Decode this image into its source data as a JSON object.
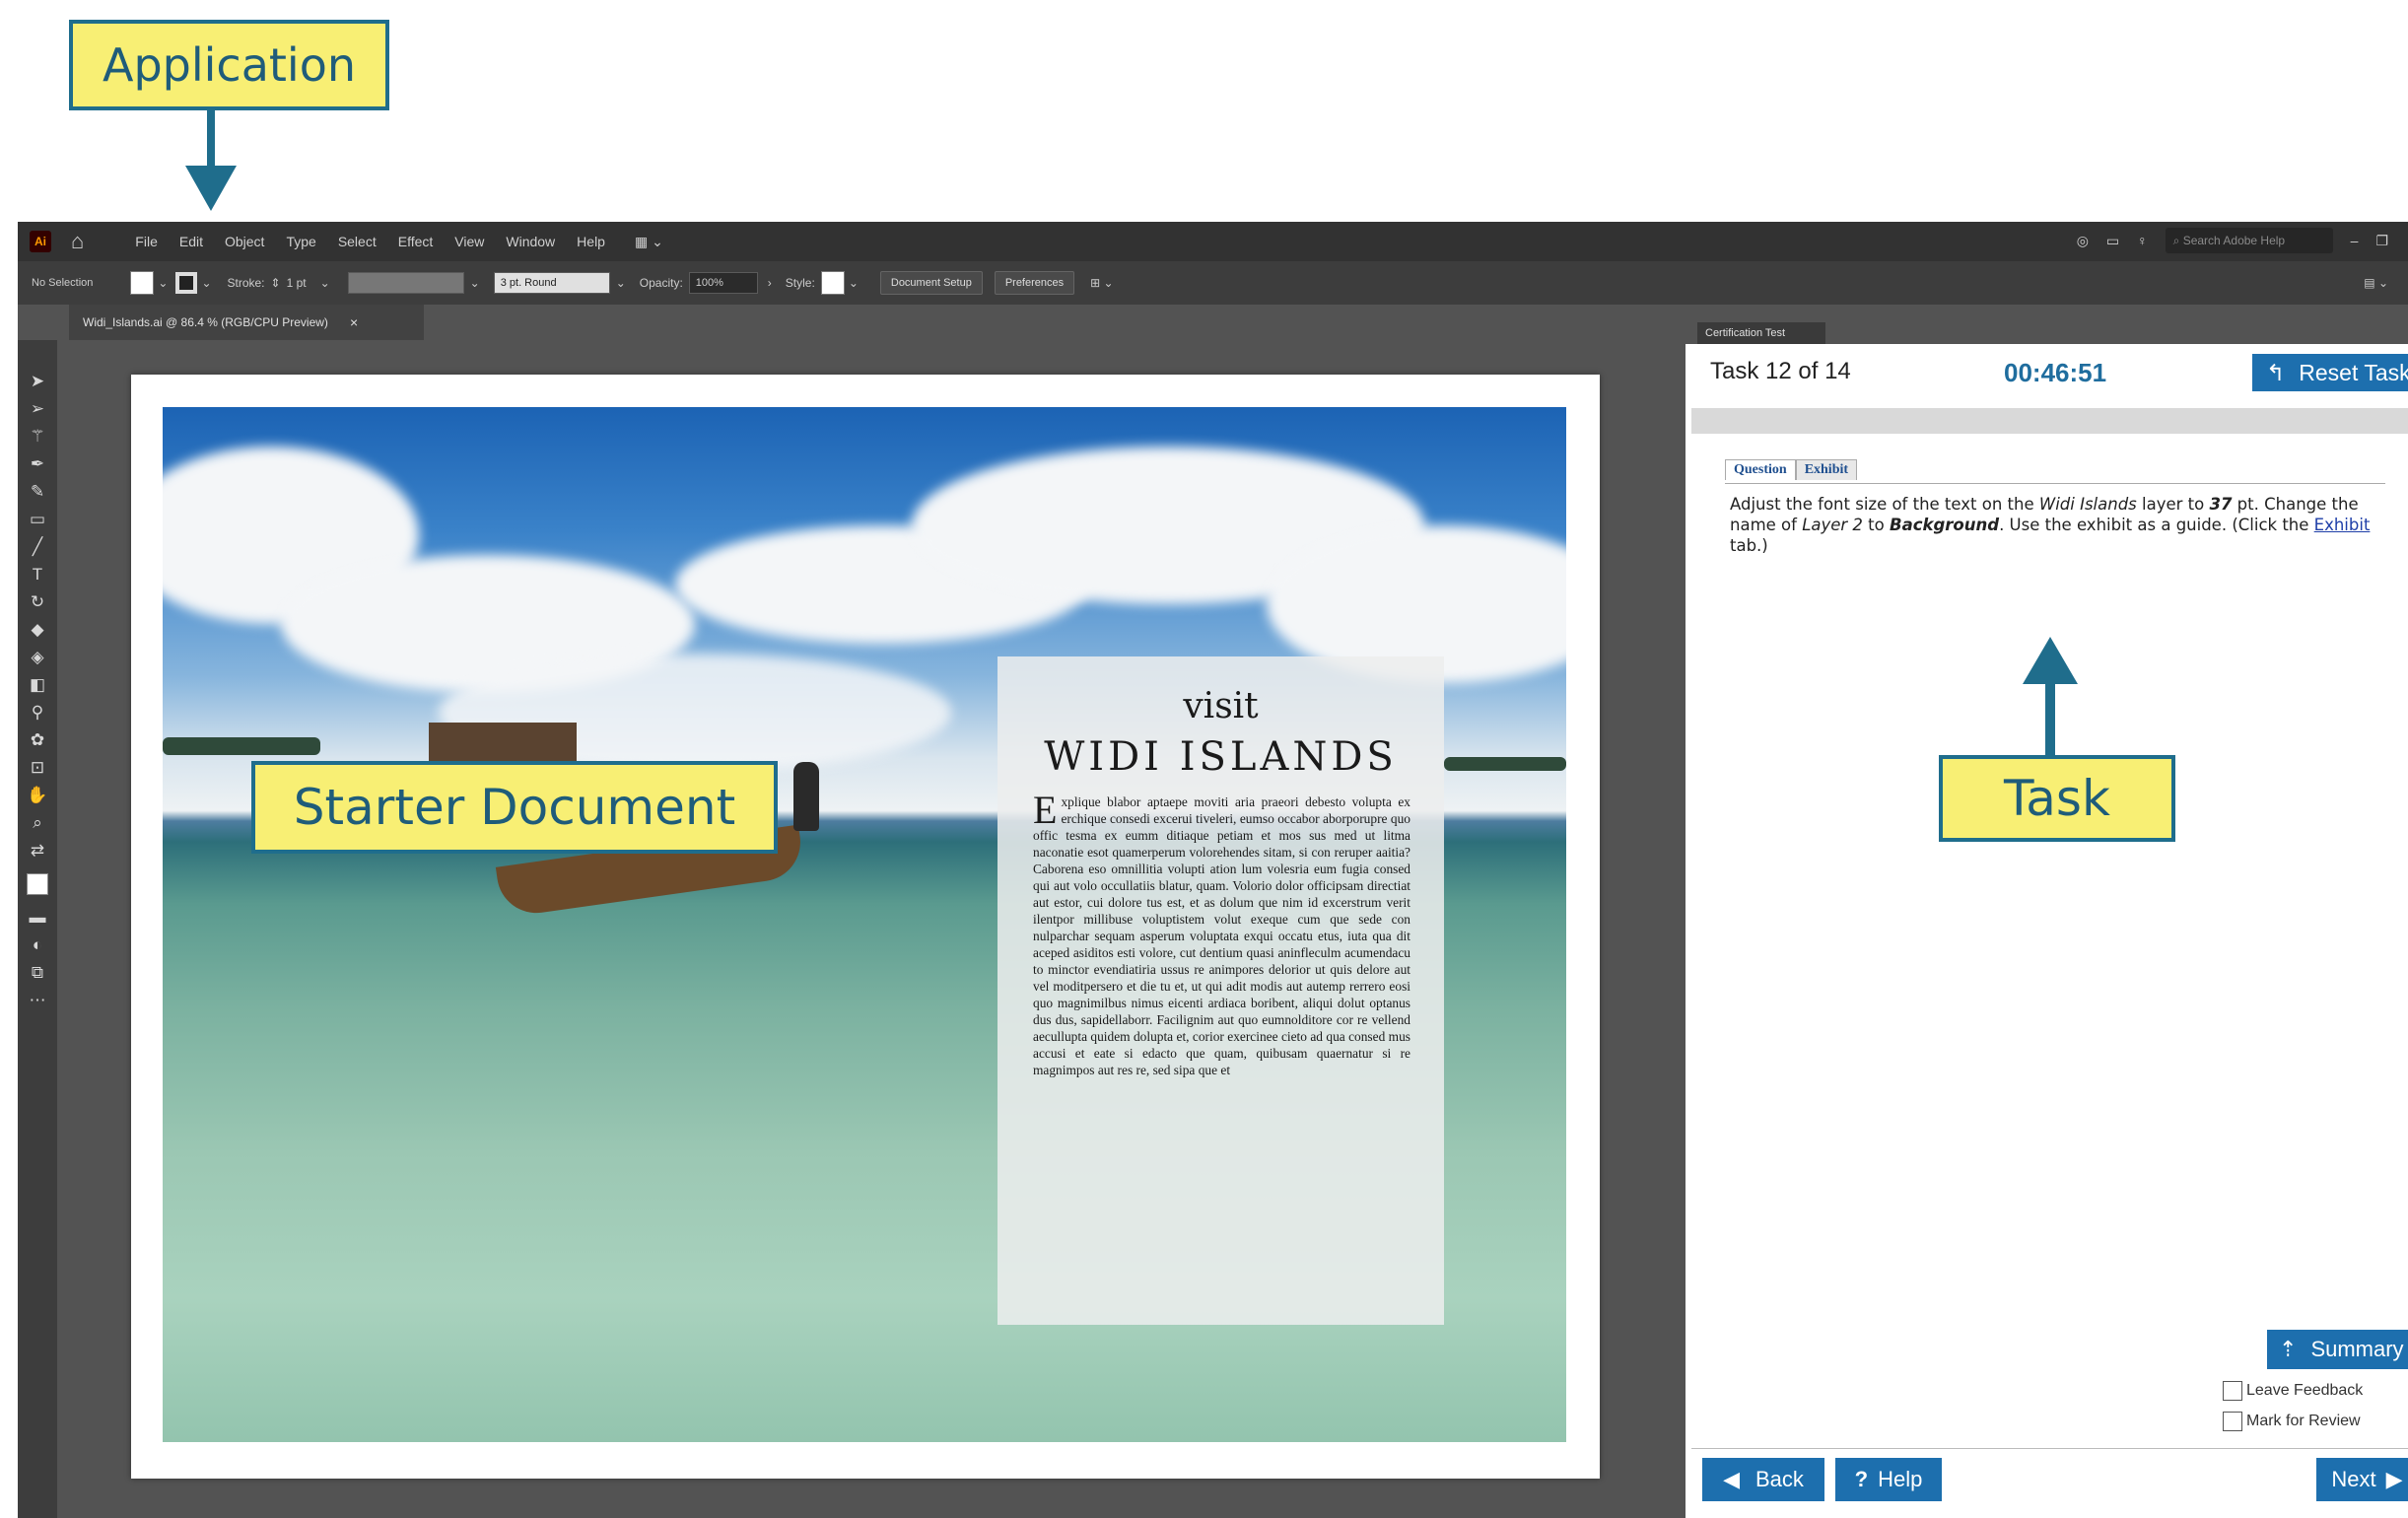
{
  "callouts": {
    "application": "Application",
    "starter": "Starter Document",
    "task": "Task"
  },
  "menubar": {
    "logo": "Ai",
    "items": [
      "File",
      "Edit",
      "Object",
      "Type",
      "Select",
      "Effect",
      "View",
      "Window",
      "Help"
    ],
    "search_placeholder": "Search Adobe Help"
  },
  "controlbar": {
    "selection": "No Selection",
    "stroke_label": "Stroke:",
    "stroke_value": "1 pt",
    "brush": "3 pt. Round",
    "opacity_label": "Opacity:",
    "opacity_value": "100%",
    "style_label": "Style:",
    "document_setup": "Document Setup",
    "preferences": "Preferences"
  },
  "document": {
    "tab_title": "Widi_Islands.ai @ 86.4 % (RGB/CPU Preview)",
    "close_icon": "×",
    "visit": "visit",
    "title": "WIDI ISLANDS",
    "dropcap": "E",
    "body": "xplique blabor aptaepe moviti aria praeori debesto volupta ex erchique consedi excerui tiveleri, eumso occabor aborporupre quo offic tesma ex eumm ditiaque petiam et mos sus med ut litma naconatie esot quamerperum volorehendes sitam, si con reruper aaitia? Caborena eso omnillitia volupti ation lum volesria eum fugia consed qui aut volo occullatiis blatur, quam. Volorio dolor officipsam directiat aut estor, cui dolore tus est, et as dolum que nim id excerstrum verit ilentpor millibuse voluptistem volut exeque cum que sede con nulparchar sequam asperum voluptata exqui occatu etus, iuta qua dit aceped asiditos esti volore, cut dentium quasi aninfleculm acumendacu to minctor evendiatiria ussus re animpores delorior ut quis delore aut vel moditpersero et die tu et, ut qui adit modis aut autemp rerrero eosi quo magnimilbus nimus eicenti ardiaca boribent, aliqui dolut optanus dus dus, sapidellaborr. Facilignim aut quo eumnolditore cor re vellend aecullupta quidem dolupta et, corior exercinee cieto ad qua consed mus accusi et eate si edacto que quam, quibusam quaernatur si re magnimpos aut res re, sed sipa que et"
  },
  "panel": {
    "tab_label": "Certification Test",
    "task_count": "Task 12 of 14",
    "timer": "00:46:51",
    "reset_label": "Reset Task",
    "tabs": [
      "Question",
      "Exhibit"
    ],
    "question_p1": "Adjust the font size of the text on the ",
    "question_em1": "Widi Islands",
    "question_p2": " layer to ",
    "question_b1": "37",
    "question_p3": " pt.  Change the name of ",
    "question_em2": "Layer 2",
    "question_p4": " to ",
    "question_b2": "Background",
    "question_p5": ". Use the exhibit as a guide. (Click the ",
    "question_link": "Exhibit",
    "question_p6": " tab.)",
    "summary_label": "Summary",
    "leave_feedback": "Leave Feedback",
    "mark_review": "Mark for Review",
    "back_label": "Back",
    "help_label": "Help",
    "next_label": "Next"
  },
  "colors": {
    "callout_fill": "#f8ef74",
    "callout_border": "#1f6d8c",
    "button_blue": "#1d6fae",
    "app_dark": "#323232"
  }
}
